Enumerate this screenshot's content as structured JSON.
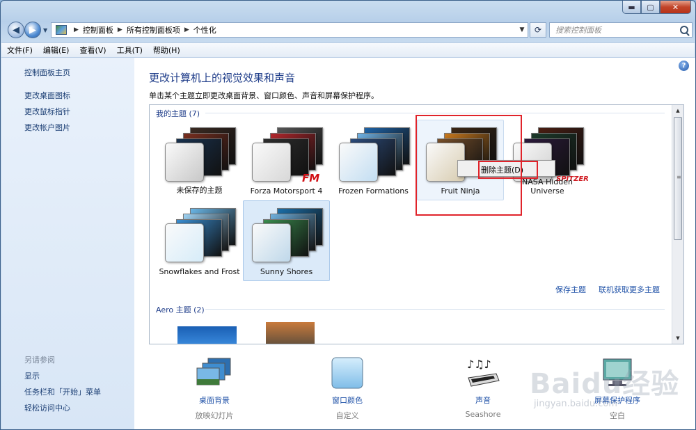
{
  "window": {
    "caption_buttons": {
      "minimize": "▬",
      "maximize": "▢",
      "close": "✕"
    }
  },
  "address": {
    "crumbs": [
      "控制面板",
      "所有控制面板项",
      "个性化"
    ],
    "search_placeholder": "搜索控制面板"
  },
  "menu": [
    "文件(F)",
    "编辑(E)",
    "查看(V)",
    "工具(T)",
    "帮助(H)"
  ],
  "sidebar": {
    "home": "控制面板主页",
    "links": [
      "更改桌面图标",
      "更改鼠标指针",
      "更改帐户图片"
    ],
    "see_also_title": "另请参阅",
    "see_also": [
      "显示",
      "任务栏和「开始」菜单",
      "轻松访问中心"
    ]
  },
  "main": {
    "title": "更改计算机上的视觉效果和声音",
    "subtitle": "单击某个主题立即更改桌面背景、窗口颜色、声音和屏幕保护程序。",
    "my_themes_header": "我的主题 (7)",
    "aero_header": "Aero 主题 (2)",
    "themes": [
      {
        "name": "未保存的主题",
        "colors": [
          "#3a2a22",
          "#7a2f1f",
          "#19324f"
        ],
        "swatch": "#c8c8c8"
      },
      {
        "name": "Forza Motorsport 4",
        "colors": [
          "#555",
          "#b3262b",
          "#2e2e2e"
        ],
        "swatch": "#d8d8d8"
      },
      {
        "name": "Frozen Formations",
        "colors": [
          "#1e63a6",
          "#6fb2e5",
          "#2c4c7c"
        ],
        "swatch": "#c3def2"
      },
      {
        "name": "Fruit Ninja",
        "colors": [
          "#3a2614",
          "#c8781c",
          "#78502a"
        ],
        "swatch": "#d8ccb0"
      },
      {
        "name": "NASA Hidden Universe",
        "colors": [
          "#4a1e12",
          "#1c3a2a",
          "#2c1a3c"
        ],
        "swatch": "#cfcfcf"
      },
      {
        "name": "Snowflakes and Frost",
        "colors": [
          "#6ab6e6",
          "#9fd3f4",
          "#3a8ed2"
        ],
        "swatch": "#d6ecf9"
      },
      {
        "name": "Sunny Shores",
        "colors": [
          "#1b6ea8",
          "#6fb0de",
          "#3a8c4e"
        ],
        "swatch": "#bfd8ea"
      }
    ],
    "context_menu_item": "删除主题(D)",
    "save_theme": "保存主题",
    "get_more": "联机获取更多主题",
    "help_icon": "?"
  },
  "options": [
    {
      "label": "桌面背景",
      "value": "放映幻灯片",
      "icon": "desktop-background-icon"
    },
    {
      "label": "窗口颜色",
      "value": "自定义",
      "icon": "window-color-icon"
    },
    {
      "label": "声音",
      "value": "Seashore",
      "icon": "sounds-icon"
    },
    {
      "label": "屏幕保护程序",
      "value": "空白",
      "icon": "screensaver-icon"
    }
  ],
  "watermark": {
    "brand": "Baidu经验",
    "url": "jingyan.baidu.com"
  }
}
